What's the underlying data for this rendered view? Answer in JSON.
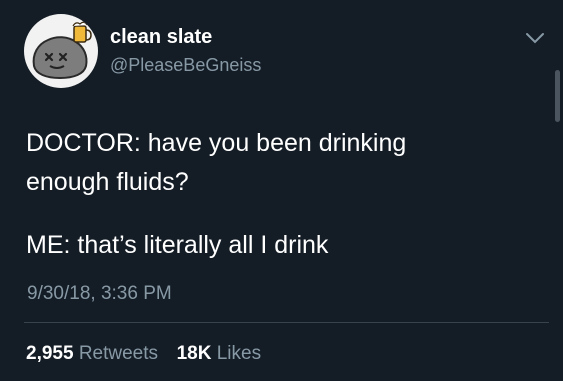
{
  "user": {
    "display_name": "clean slate",
    "handle": "@PleaseBeGneiss",
    "avatar_icon": "rock-with-beer-avatar"
  },
  "tweet": {
    "line1": "DOCTOR: have you been drinking",
    "line2": "enough fluids?",
    "line3": "ME: that’s literally all I drink",
    "timestamp": "9/30/18, 3:36 PM"
  },
  "stats": {
    "retweets_count": "2,955",
    "retweets_label": "Retweets",
    "likes_count": "18K",
    "likes_label": "Likes"
  },
  "colors": {
    "background": "#141d26",
    "text": "#ffffff",
    "secondary_text": "#8899a6",
    "divider": "#38444d"
  },
  "icons": {
    "menu": "chevron-down-icon"
  }
}
